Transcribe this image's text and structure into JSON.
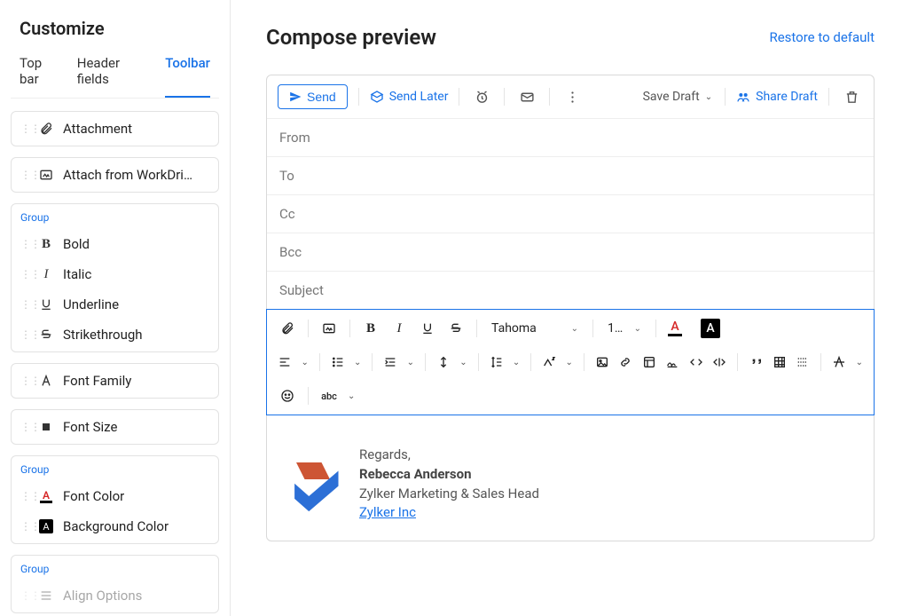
{
  "sidebar": {
    "title": "Customize",
    "tabs": [
      {
        "label": "Top bar",
        "active": false
      },
      {
        "label": "Header fields",
        "active": false
      },
      {
        "label": "Toolbar",
        "active": true
      }
    ],
    "block_attachment": {
      "label": "Attachment"
    },
    "block_workdrive": {
      "label": "Attach from WorkDri…"
    },
    "group1_label": "Group",
    "group1": {
      "bold": "Bold",
      "italic": "Italic",
      "underline": "Underline",
      "strike": "Strikethrough"
    },
    "block_font_family": {
      "label": "Font Family"
    },
    "block_font_size": {
      "label": "Font Size"
    },
    "group2_label": "Group",
    "group2": {
      "font_color": "Font Color",
      "bg_color": "Background Color"
    },
    "group3_label": "Group",
    "group3": {
      "align_options": "Align Options"
    }
  },
  "main": {
    "title": "Compose preview",
    "restore": "Restore to default",
    "toolbar": {
      "send": "Send",
      "send_later": "Send Later",
      "save_draft": "Save Draft",
      "share_draft": "Share Draft"
    },
    "fields": {
      "from": "From",
      "to": "To",
      "cc": "Cc",
      "bcc": "Bcc",
      "subject": "Subject"
    },
    "format": {
      "font_family": "Tahoma",
      "font_size": "1…"
    },
    "signature": {
      "regards": "Regards,",
      "name": "Rebecca Anderson",
      "title": "Zylker Marketing & Sales Head",
      "company": "Zylker Inc"
    }
  }
}
